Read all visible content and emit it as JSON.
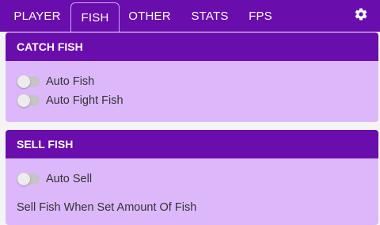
{
  "tabs": [
    {
      "label": "PLAYER"
    },
    {
      "label": "FISH"
    },
    {
      "label": "OTHER"
    },
    {
      "label": "STATS"
    },
    {
      "label": "FPS"
    }
  ],
  "active_tab": "FISH",
  "settings_icon": "gear-icon",
  "colors": {
    "header": "#6a0dad",
    "panel_body": "#dcb8fb",
    "toggle_off": "#c4c4c4"
  },
  "catch_fish": {
    "title": "CATCH FISH",
    "options": [
      {
        "label": "Auto Fish",
        "enabled": false
      },
      {
        "label": "Auto Fight Fish",
        "enabled": false
      }
    ]
  },
  "sell_fish": {
    "title": "SELL FISH",
    "options": [
      {
        "label": "Auto Sell",
        "enabled": false
      }
    ],
    "amount_label": "Sell Fish When Set Amount Of Fish"
  }
}
